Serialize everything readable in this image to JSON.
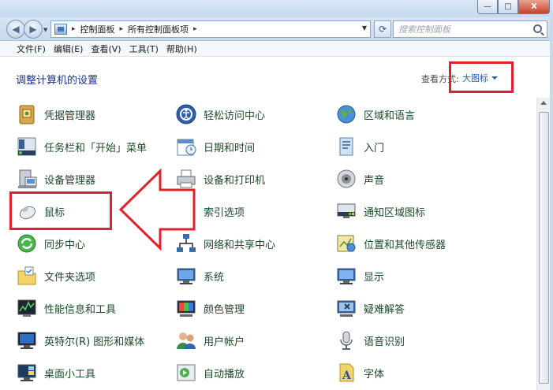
{
  "window": {
    "minimize_glyph": "—",
    "maximize_glyph": "□",
    "close_glyph": "X"
  },
  "address": {
    "breadcrumbs": [
      "控制面板",
      "所有控制面板项"
    ],
    "separator": "▸"
  },
  "search": {
    "placeholder": "搜索控制面板"
  },
  "menubar": [
    "文件(F)",
    "编辑(E)",
    "查看(V)",
    "工具(T)",
    "帮助(H)"
  ],
  "header": {
    "title": "调整计算机的设置",
    "view_by_label": "查看方式:",
    "view_by_value": "大图标"
  },
  "items": {
    "col1": [
      "凭据管理器",
      "任务栏和「开始」菜单",
      "设备管理器",
      "鼠标",
      "同步中心",
      "文件夹选项",
      "性能信息和工具",
      "英特尔(R) 图形和媒体",
      "桌面小工具"
    ],
    "col2": [
      "轻松访问中心",
      "日期和时间",
      "设备和打印机",
      "索引选项",
      "网络和共享中心",
      "系统",
      "颜色管理",
      "用户帐户",
      "自动播放"
    ],
    "col3": [
      "区域和语言",
      "入门",
      "声音",
      "通知区域图标",
      "位置和其他传感器",
      "显示",
      "疑难解答",
      "语音识别",
      "字体"
    ]
  },
  "annotation": {
    "highlight_color": "#e0222d",
    "highlighted_item": "鼠标",
    "highlighted_control": "大图标"
  },
  "colors": {
    "link_green": "#1d4a28",
    "title_blue": "#1e3287",
    "dropdown_blue": "#1a5fb4"
  }
}
